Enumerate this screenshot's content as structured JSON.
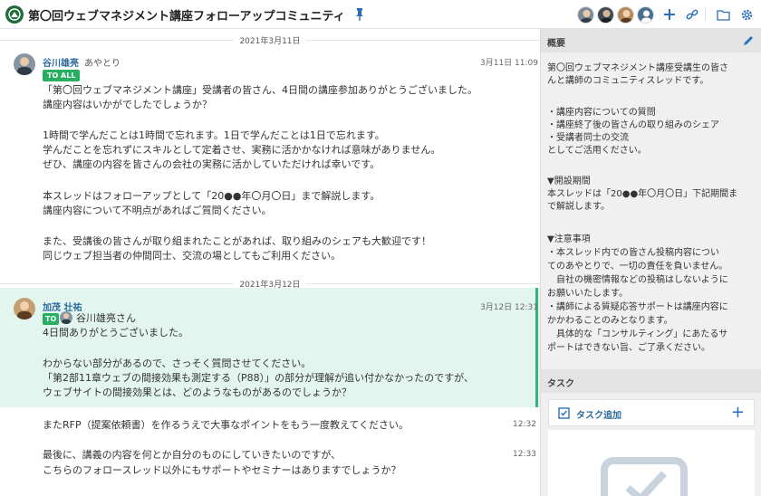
{
  "header": {
    "title": "第〇回ウェブマネジメント講座フォローアップコミュニティ"
  },
  "chat": {
    "dates": [
      "2021年3月11日",
      "2021年3月12日"
    ],
    "messages": [
      {
        "author": "谷川雄亮",
        "subtitle": "あやとり",
        "time": "3月11日 11:09",
        "badge": "TO ALL",
        "lines": [
          "「第〇回ウェブマネジメント講座」受講者の皆さん、4日間の講座参加ありがとうございました。",
          "講座内容はいかがでしたでしょうか？",
          "",
          "1時間で学んだことは1時間で忘れます。1日で学んだことは1日で忘れます。",
          "学んだことを忘れずにスキルとして定着させ、実務に活かかなければ意味がありません。",
          "ぜひ、講座の内容を皆さんの会社の実務に活かしていただければ幸いです。",
          "",
          "本スレッドはフォローアップとして「20●●年〇月〇日」まで解説します。",
          "講座内容について不明点があればご質問ください。",
          "",
          "また、受講後の皆さんが取り組まれたことがあれば、取り組みのシェアも大歓迎です！",
          "同じウェブ担当者の仲間同士、交流の場としてもご利用ください。"
        ]
      },
      {
        "author": "加茂 壮祐",
        "time": "3月12日 12:31",
        "to_badge": "TO",
        "to_name": "谷川雄亮さん",
        "lines": [
          "4日間ありがとうございました。",
          "",
          "わからない部分があるので、さっそく質問させてください。",
          "「第2部11章ウェブの間接効果も測定する（P88）」の部分が理解が追い付かなかったのですが、",
          "ウェブサイトの間接効果とは、どのようなものがあるのでしょうか？"
        ]
      },
      {
        "time": "12:32",
        "lines": [
          "またRFP（提案依頼書）を作るうえで大事なポイントをもう一度教えてください。"
        ]
      },
      {
        "time": "12:33",
        "lines": [
          "最後に、講義の内容を何とか自分のものにしていきたいのですが、",
          "こちらのフォロースレッド以外にもサポートやセミナーはありますでしょうか？"
        ]
      }
    ]
  },
  "side": {
    "overview_label": "概要",
    "overview_lines": [
      "第〇回ウェブマネジメント講座受講生の皆さ",
      "んと講師のコミュニティスレッドです。",
      "",
      "・講座内容についての質問",
      "・講座終了後の皆さんの取り組みのシェア",
      "・受講者同士の交流",
      "としてご活用ください。",
      "",
      "▼開設期間",
      "本スレッドは「20●●年〇月〇日」下記期間ま",
      "で解説します。",
      "",
      "▼注意事項",
      "・本スレッド内での皆さん投稿内容につい",
      "てのあやとりで、一切の責任を負いません。",
      "　自社の機密情報などの投稿はしないように",
      "お願いいたします。",
      "・講師による質疑応答サポートは講座内容に",
      "かかわることのみとなります。",
      "　具体的な「コンサルティング」にあたるサ",
      "ポートはできない旨、ご了承ください。"
    ],
    "task_label": "タスク",
    "task_add_label": "タスク追加",
    "task_plus": "+"
  },
  "colors": {
    "accent": "#2a6ebb",
    "badge_green": "#27ae60",
    "highlight_bg": "#e3f5ef",
    "highlight_bar": "#38b27a"
  }
}
